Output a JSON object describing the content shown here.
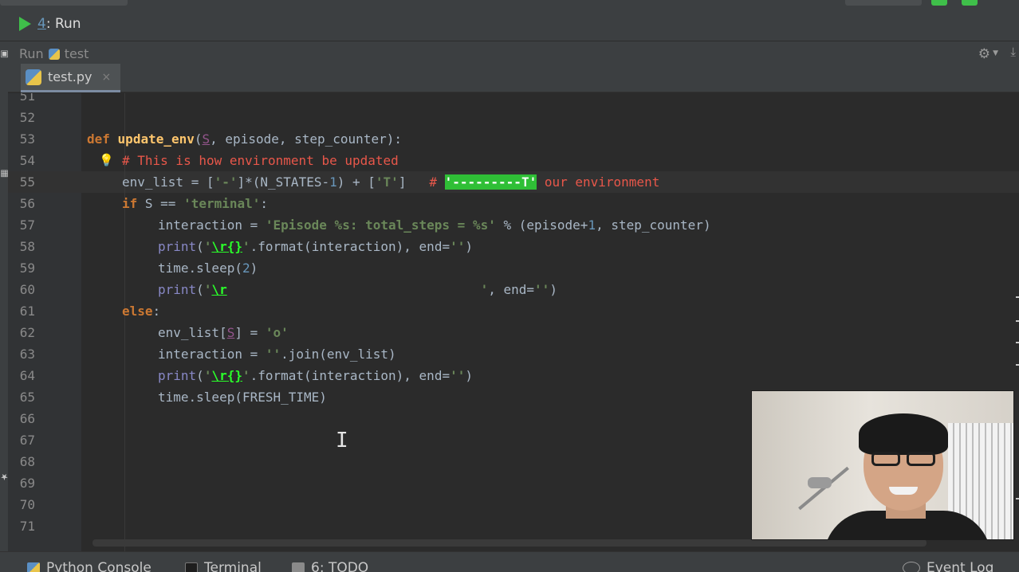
{
  "run_panel": {
    "tab_number": "4",
    "tab_label": ": Run",
    "toolbar_label": "Run",
    "config_name": "test"
  },
  "editor_tab": {
    "file_name": "test.py",
    "close": "×"
  },
  "gutter": {
    "line_numbers": [
      "51",
      "52",
      "53",
      "54",
      "55",
      "56",
      "57",
      "58",
      "59",
      "60",
      "61",
      "62",
      "63",
      "64",
      "65",
      "66",
      "67",
      "68",
      "69",
      "70",
      "71"
    ]
  },
  "code": {
    "l53": {
      "kw": "def",
      "fn": "update_env",
      "open": "(",
      "p1": "S",
      "rest": ", episode, step_counter):"
    },
    "l54": {
      "comment": "# This is how environment be updated"
    },
    "l55": {
      "a": "env_list = [",
      "s1": "'-'",
      "b": "]*(N_STATES-",
      "n1": "1",
      "c": ") + [",
      "s2": "'T'",
      "d": "]   ",
      "cmt": "# ",
      "hl": "'---------T'",
      "cmt2": " our environment"
    },
    "l56": {
      "kw": "if",
      "a": " S == ",
      "s": "'terminal'",
      "b": ":"
    },
    "l57": {
      "a": "interaction = ",
      "s": "'Episode %s: total_steps = %s'",
      "b": " % (episode+",
      "n": "1",
      "c": ", step_counter)"
    },
    "l58": {
      "f": "print",
      "a": "(",
      "q": "'",
      "esc1": "\\r",
      "b": "{}",
      "q2": "'",
      "c": ".format(interaction), end=",
      "s": "''",
      "d": ")"
    },
    "l59": {
      "a": "time.sleep(",
      "n": "2",
      "b": ")"
    },
    "l60": {
      "f": "print",
      "a": "(",
      "q": "'",
      "esc": "\\r",
      "sp": "                                 ",
      "q2": "'",
      "b": ", end=",
      "s": "''",
      "c": ")"
    },
    "l61": {
      "kw": "else",
      "b": ":"
    },
    "l62": {
      "a": "env_list[",
      "p": "S",
      "b": "] = ",
      "s": "'o'"
    },
    "l63": {
      "a": "interaction = ",
      "s": "''",
      "b": ".join(env_list)"
    },
    "l64": {
      "f": "print",
      "a": "(",
      "q": "'",
      "esc1": "\\r",
      "b": "{}",
      "q2": "'",
      "c": ".format(interaction), end=",
      "s": "''",
      "d": ")"
    },
    "l65": {
      "a": "time.sleep(FRESH_TIME)"
    }
  },
  "bottom_bar": {
    "python_console": "Python Console",
    "terminal": "Terminal",
    "todo": "6: TODO",
    "event_log": "Event Log"
  },
  "colors": {
    "keyword": "#cc7832",
    "function": "#ffc66d",
    "string": "#6a8759",
    "comment": "#e8574a",
    "highlight": "#2fbf36",
    "run_green": "#3fbf4a"
  }
}
